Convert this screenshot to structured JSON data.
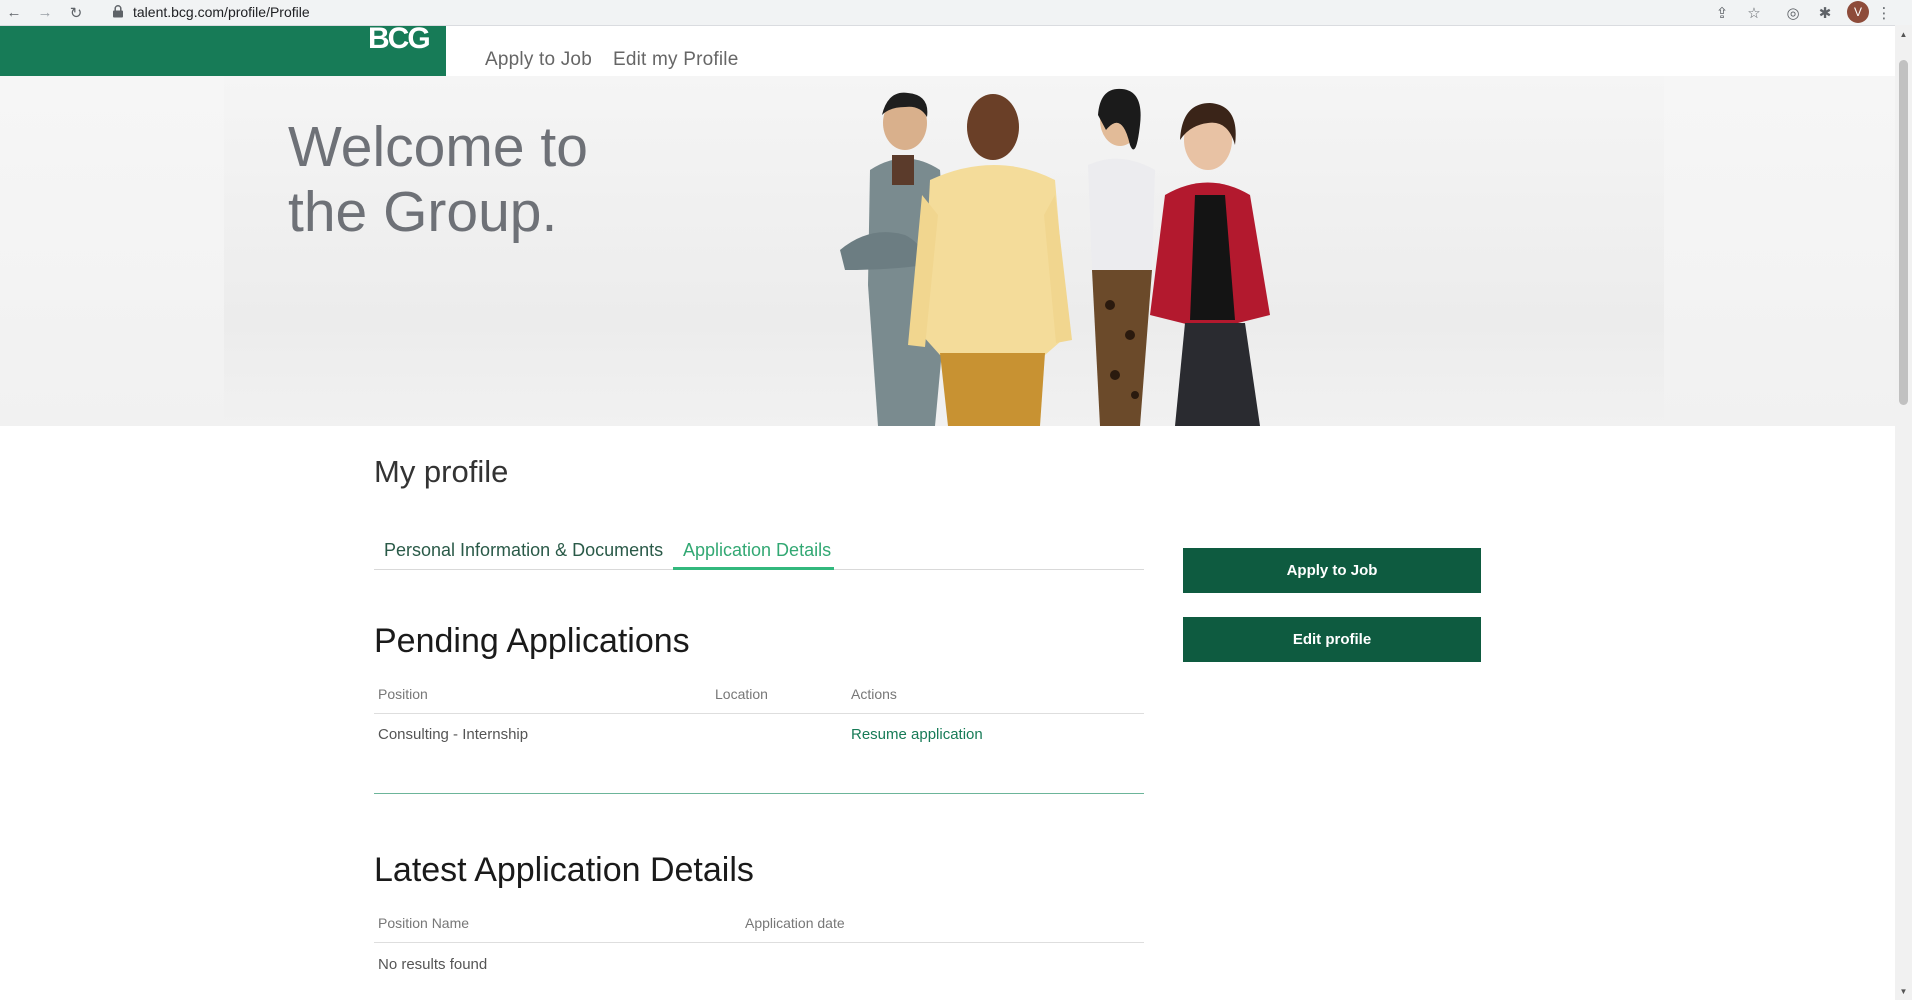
{
  "browser": {
    "url": "talent.bcg.com/profile/Profile",
    "avatar_letter": "V"
  },
  "header": {
    "logo_text": "BCG",
    "nav": [
      "Apply to Job",
      "Edit my Profile"
    ],
    "brand_color": "#177b57"
  },
  "hero": {
    "title_line1": "Welcome to",
    "title_line2": "the Group."
  },
  "profile": {
    "title": "My profile",
    "tabs": [
      {
        "label": "Personal Information & Documents",
        "active": false
      },
      {
        "label": "Application Details",
        "active": true
      }
    ],
    "buttons": {
      "apply": "Apply to Job",
      "edit": "Edit profile"
    }
  },
  "pending": {
    "title": "Pending Applications",
    "columns": [
      "Position",
      "Location",
      "Actions"
    ],
    "rows": [
      {
        "position": "Consulting - Internship",
        "location": "",
        "action": "Resume application"
      }
    ]
  },
  "latest": {
    "title": "Latest Application Details",
    "columns": [
      "Position Name",
      "Application date"
    ],
    "empty_text": "No results found"
  }
}
